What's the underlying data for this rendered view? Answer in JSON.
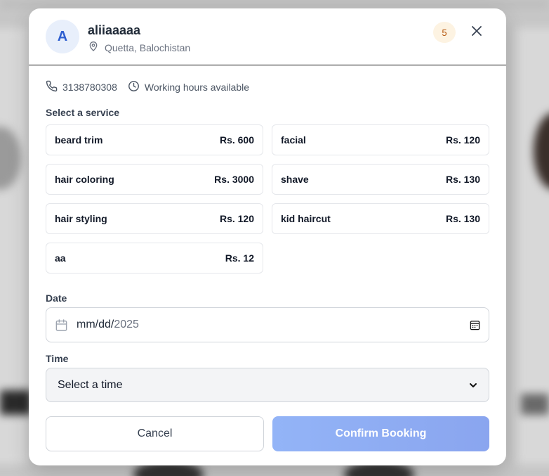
{
  "provider": {
    "avatar_initial": "A",
    "name": "aliiaaaaa",
    "location": "Quetta, Balochistan",
    "rating_badge": "5"
  },
  "contact": {
    "phone": "3138780308",
    "hours": "Working hours available"
  },
  "services_label": "Select a service",
  "services": [
    {
      "name": "beard trim",
      "price": "Rs. 600"
    },
    {
      "name": "facial",
      "price": "Rs. 120"
    },
    {
      "name": "hair coloring",
      "price": "Rs. 3000"
    },
    {
      "name": "shave",
      "price": "Rs. 130"
    },
    {
      "name": "hair styling",
      "price": "Rs. 120"
    },
    {
      "name": "kid haircut",
      "price": "Rs. 130"
    },
    {
      "name": "aa",
      "price": "Rs. 12"
    }
  ],
  "date": {
    "label": "Date",
    "value_prefix": "mm/dd/",
    "value_year": "2025"
  },
  "time": {
    "label": "Time",
    "selected": "Select a time"
  },
  "actions": {
    "cancel": "Cancel",
    "confirm": "Confirm Booking"
  },
  "colors": {
    "accent": "#2f5fd0",
    "confirm_button": "#8fadf4",
    "badge_text": "#b45309"
  },
  "icons": {
    "location": "map-pin-icon",
    "phone": "phone-icon",
    "hours": "clock-icon",
    "close": "close-icon",
    "date": "calendar-icon",
    "time_select": "chevron-down-icon"
  }
}
